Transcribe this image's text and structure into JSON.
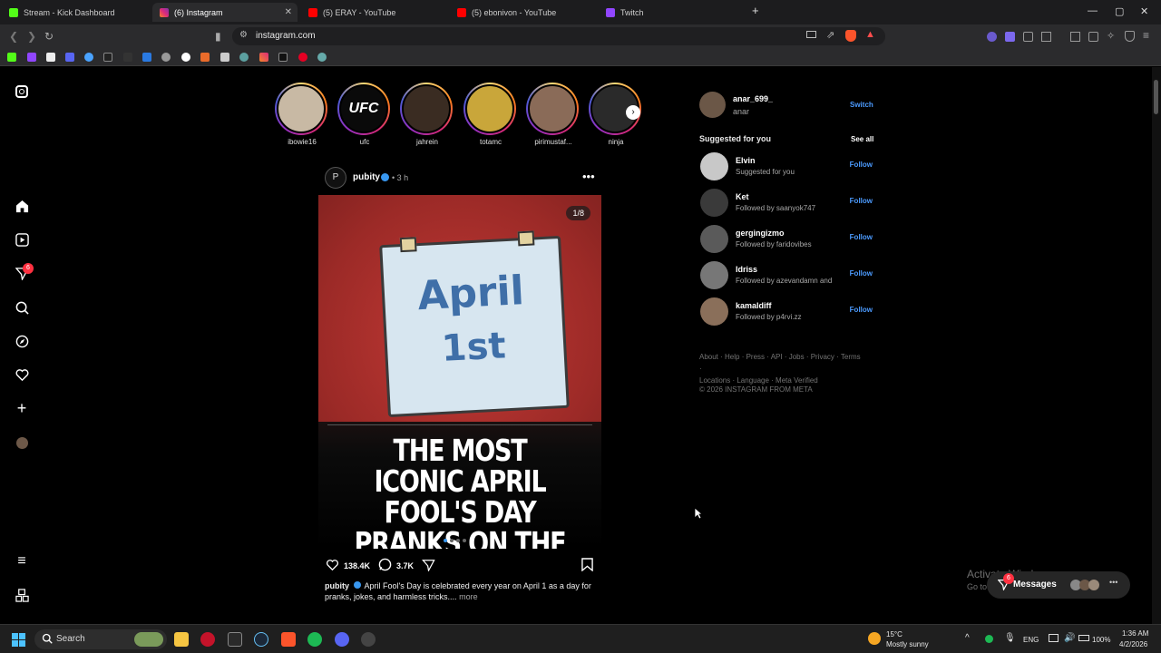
{
  "browser": {
    "tabs": [
      {
        "label": "Stream - Kick Dashboard",
        "color": "#53fc18"
      },
      {
        "label": "(6) Instagram",
        "color": "#e1306c"
      },
      {
        "label": "(5) ERAY - YouTube",
        "color": "#ff0000"
      },
      {
        "label": "(5) ebonivon - YouTube",
        "color": "#ff0000"
      },
      {
        "label": "Twitch",
        "color": "#9146ff"
      }
    ],
    "url": "instagram.com"
  },
  "sidebar": {
    "notifications_badge": "6"
  },
  "stories": [
    {
      "name": "ibowie16"
    },
    {
      "name": "ufc",
      "logo_text": "UFC"
    },
    {
      "name": "jahrein"
    },
    {
      "name": "totamc"
    },
    {
      "name": "pirimustaf..."
    },
    {
      "name": "ninja"
    }
  ],
  "post": {
    "author": "pubity",
    "time": "• 3 h",
    "counter": "1/8",
    "image_calendar_text_1": "April",
    "image_calendar_text_2": "1st",
    "headline": "THE MOST ICONIC APRIL FOOL'S DAY PRANKS ON THE INTERNET",
    "likes": "138.4K",
    "comments": "3.7K",
    "caption_user": "pubity",
    "caption_text": "April Fool's Day is celebrated every year on April 1 as a day for pranks, jokes, and harmless tricks....",
    "more_label": "more"
  },
  "account": {
    "username": "anar_699_",
    "name": "anar",
    "switch_label": "Switch"
  },
  "suggested": {
    "heading": "Suggested for you",
    "see_all": "See all",
    "follow_label": "Follow",
    "items": [
      {
        "username": "Elvin",
        "sub": "Suggested for you"
      },
      {
        "username": "Ket",
        "sub": "Followed by saanyok747"
      },
      {
        "username": "gergingizmo",
        "sub": "Followed by faridovibes"
      },
      {
        "username": "Idriss",
        "sub": "Followed by azevandamn and"
      },
      {
        "username": "kamaldiff",
        "sub": "Followed by p4rvi.zz"
      }
    ]
  },
  "footer": {
    "links_line1": "About · Help · Press · API · Jobs · Privacy · Terms ·",
    "links_line2": "Locations · Language · Meta Verified",
    "copyright": "© 2026 INSTAGRAM FROM META"
  },
  "overlay": {
    "activate_title": "Activate Windows",
    "activate_sub": "Go to",
    "messages_label": "Messages",
    "messages_badge": "6"
  },
  "taskbar": {
    "search_label": "Search",
    "weather_temp": "15°C",
    "weather_desc": "Mostly sunny",
    "lang": "ENG",
    "battery": "100%",
    "time": "1:36 AM",
    "date": "4/2/2026"
  }
}
